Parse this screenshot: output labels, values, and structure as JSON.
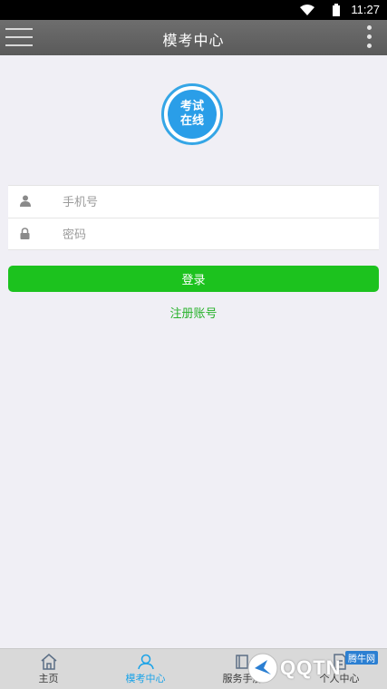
{
  "status_bar": {
    "time": "11:27"
  },
  "app_bar": {
    "title": "模考中心"
  },
  "logo": {
    "line1": "考试",
    "line2": "在线"
  },
  "form": {
    "phone_placeholder": "手机号",
    "password_placeholder": "密码"
  },
  "login_button": "登录",
  "register_link": "注册账号",
  "tabs": [
    {
      "label": "主页",
      "icon": "home-icon"
    },
    {
      "label": "模考中心",
      "icon": "person-icon"
    },
    {
      "label": "服务手册",
      "icon": "book-icon"
    },
    {
      "label": "个人中心",
      "icon": "document-icon"
    }
  ],
  "watermark": {
    "brand": "QQTN",
    "site": "腾牛网"
  },
  "colors": {
    "accent_green": "#1cc21e",
    "link_green": "#27b22b",
    "active_tab": "#1aa3e8",
    "logo_blue": "#2a9ee8"
  }
}
